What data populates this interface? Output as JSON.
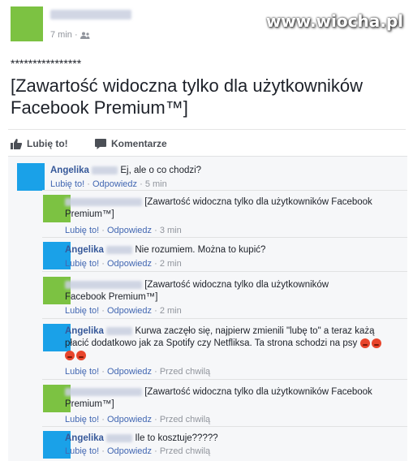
{
  "watermark": "www.wiocha.pl",
  "post": {
    "time": "7 min",
    "separator": "·",
    "stars": "****************",
    "headline": "[Zawartość widoczna tylko dla użytkowników Facebook Premium™]",
    "actions": {
      "like": "Lubię to!",
      "comment": "Komentarze"
    }
  },
  "comments": [
    {
      "name": "Angelika",
      "text": "Ej, ale o co chodzi?",
      "like": "Lubię to!",
      "reply": "Odpowiedz",
      "time": "5 min"
    },
    {
      "name": "",
      "text": "[Zawartość widoczna tylko dla użytkowników Facebook Premium™]",
      "like": "Lubię to!",
      "reply": "Odpowiedz",
      "time": "3 min"
    },
    {
      "name": "Angelika",
      "text": "Nie rozumiem. Można to kupić?",
      "like": "Lubię to!",
      "reply": "Odpowiedz",
      "time": "2 min"
    },
    {
      "name": "",
      "text": "[Zawartość widoczna tylko dla użytkowników Facebook Premium™]",
      "like": "Lubię to!",
      "reply": "Odpowiedz",
      "time": "2 min"
    },
    {
      "name": "Angelika",
      "text": "Kurwa zaczęło się, najpierw zmienili \"lubę to\" a teraz każą płacić dodatkowo jak za Spotify czy Netfliksa. Ta strona schodzi na psy",
      "like": "Lubię to!",
      "reply": "Odpowiedz",
      "time": "Przed chwilą"
    },
    {
      "name": "",
      "text": "[Zawartość widoczna tylko dla użytkowników Facebook Premium™]",
      "like": "Lubię to!",
      "reply": "Odpowiedz",
      "time": "Przed chwilą"
    },
    {
      "name": "Angelika",
      "text": "Ile to kosztuje?????",
      "like": "Lubię to!",
      "reply": "Odpowiedz",
      "time": "Przed chwilą"
    }
  ],
  "colors": {
    "green": "#7cc242",
    "blue": "#1aa1e8",
    "link": "#4267b2",
    "name": "#365899"
  }
}
